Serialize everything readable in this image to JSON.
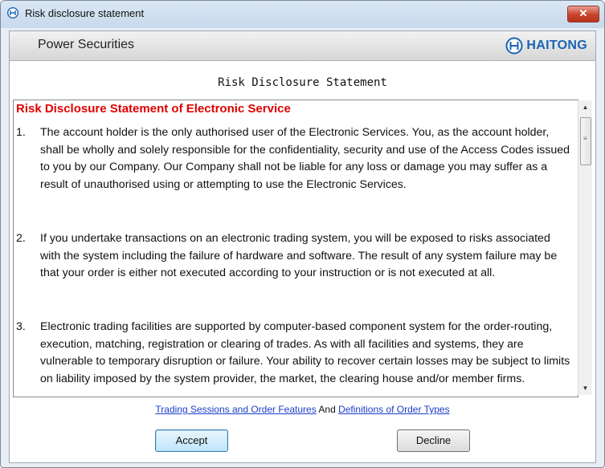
{
  "window": {
    "title": "Risk disclosure statement",
    "close_label": "✕"
  },
  "brand": {
    "name": "Power Securities",
    "logo_text": "HAITONG"
  },
  "document": {
    "title": "Risk Disclosure Statement",
    "heading": "Risk Disclosure Statement of Electronic Service",
    "items": [
      {
        "num": "1.",
        "text": "The account holder is the only authorised user of the Electronic Services. You, as the account holder, shall be wholly and solely responsible for the confidentiality, security and use of the Access Codes issued to you by our Company. Our Company shall not be liable for any loss or damage you may suffer as a result of unauthorised using or attempting to use the Electronic Services."
      },
      {
        "num": "2.",
        "text": "If you undertake transactions on an electronic trading system, you will be exposed to risks associated with the system including the failure of hardware and software. The result of any system failure may be that your order is either not executed according to your instruction or is not executed at all."
      },
      {
        "num": "3.",
        "text": "Electronic trading facilities are supported by computer-based component system for the order-routing, execution, matching, registration or clearing of trades. As with all facilities and systems, they are vulnerable to temporary disruption or failure. Your ability to recover certain losses may be subject to limits on liability imposed by the system provider, the market, the clearing house and/or member firms."
      }
    ]
  },
  "links": {
    "trading_sessions": "Trading Sessions and Order Features",
    "and": "And",
    "definitions": "Definitions of Order Types"
  },
  "buttons": {
    "accept": "Accept",
    "decline": "Decline"
  },
  "colors": {
    "heading": "#e00000",
    "link": "#1a3dcc",
    "logo": "#1b63b5"
  }
}
